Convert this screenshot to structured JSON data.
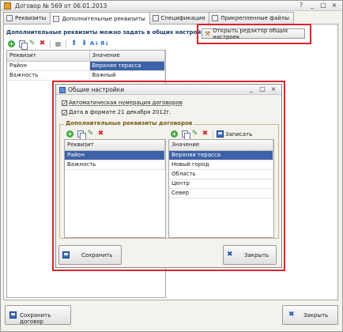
{
  "window": {
    "title": "Договор № 569 от 06.01.2013",
    "icon": "contract-icon"
  },
  "tabs": [
    {
      "label": "Реквизиты"
    },
    {
      "label": "Дополнительные реквизиты"
    },
    {
      "label": "Спецификация"
    },
    {
      "label": "Прикрепленные файлы"
    }
  ],
  "main": {
    "hint": "Дополнительные реквизиты можно задать в общих настройках",
    "open_editor_label": "Открыть редактор общих настроек",
    "table": {
      "headers": [
        "Реквизит",
        "Значение"
      ],
      "rows": [
        {
          "name": "Район",
          "value": "Верхняя терасса"
        },
        {
          "name": "Важность",
          "value": "Важный"
        }
      ]
    },
    "save_contract_label": "Сохранить договор",
    "close_label": "Закрыть"
  },
  "dialog": {
    "title": "Общие настройки",
    "checkboxes": [
      {
        "label": "Автоматическая нумерация договоров",
        "checked": true
      },
      {
        "label": "Дата в формате 21 декабря 2012г.",
        "checked": true
      }
    ],
    "group_label": "Дополнительные реквизиты договоров",
    "left_table": {
      "header": "Реквизит",
      "rows": [
        "Район",
        "Важность"
      ]
    },
    "right_table": {
      "header": "Значение",
      "rows": [
        "Верхняя терасса",
        "Новый город",
        "Область",
        "Центр",
        "Север"
      ]
    },
    "write_label": "Записать",
    "save_label": "Сохранить",
    "close_label": "Закрыть"
  },
  "colors": {
    "highlight": "#d9232e",
    "selection": "#3e62a8"
  }
}
